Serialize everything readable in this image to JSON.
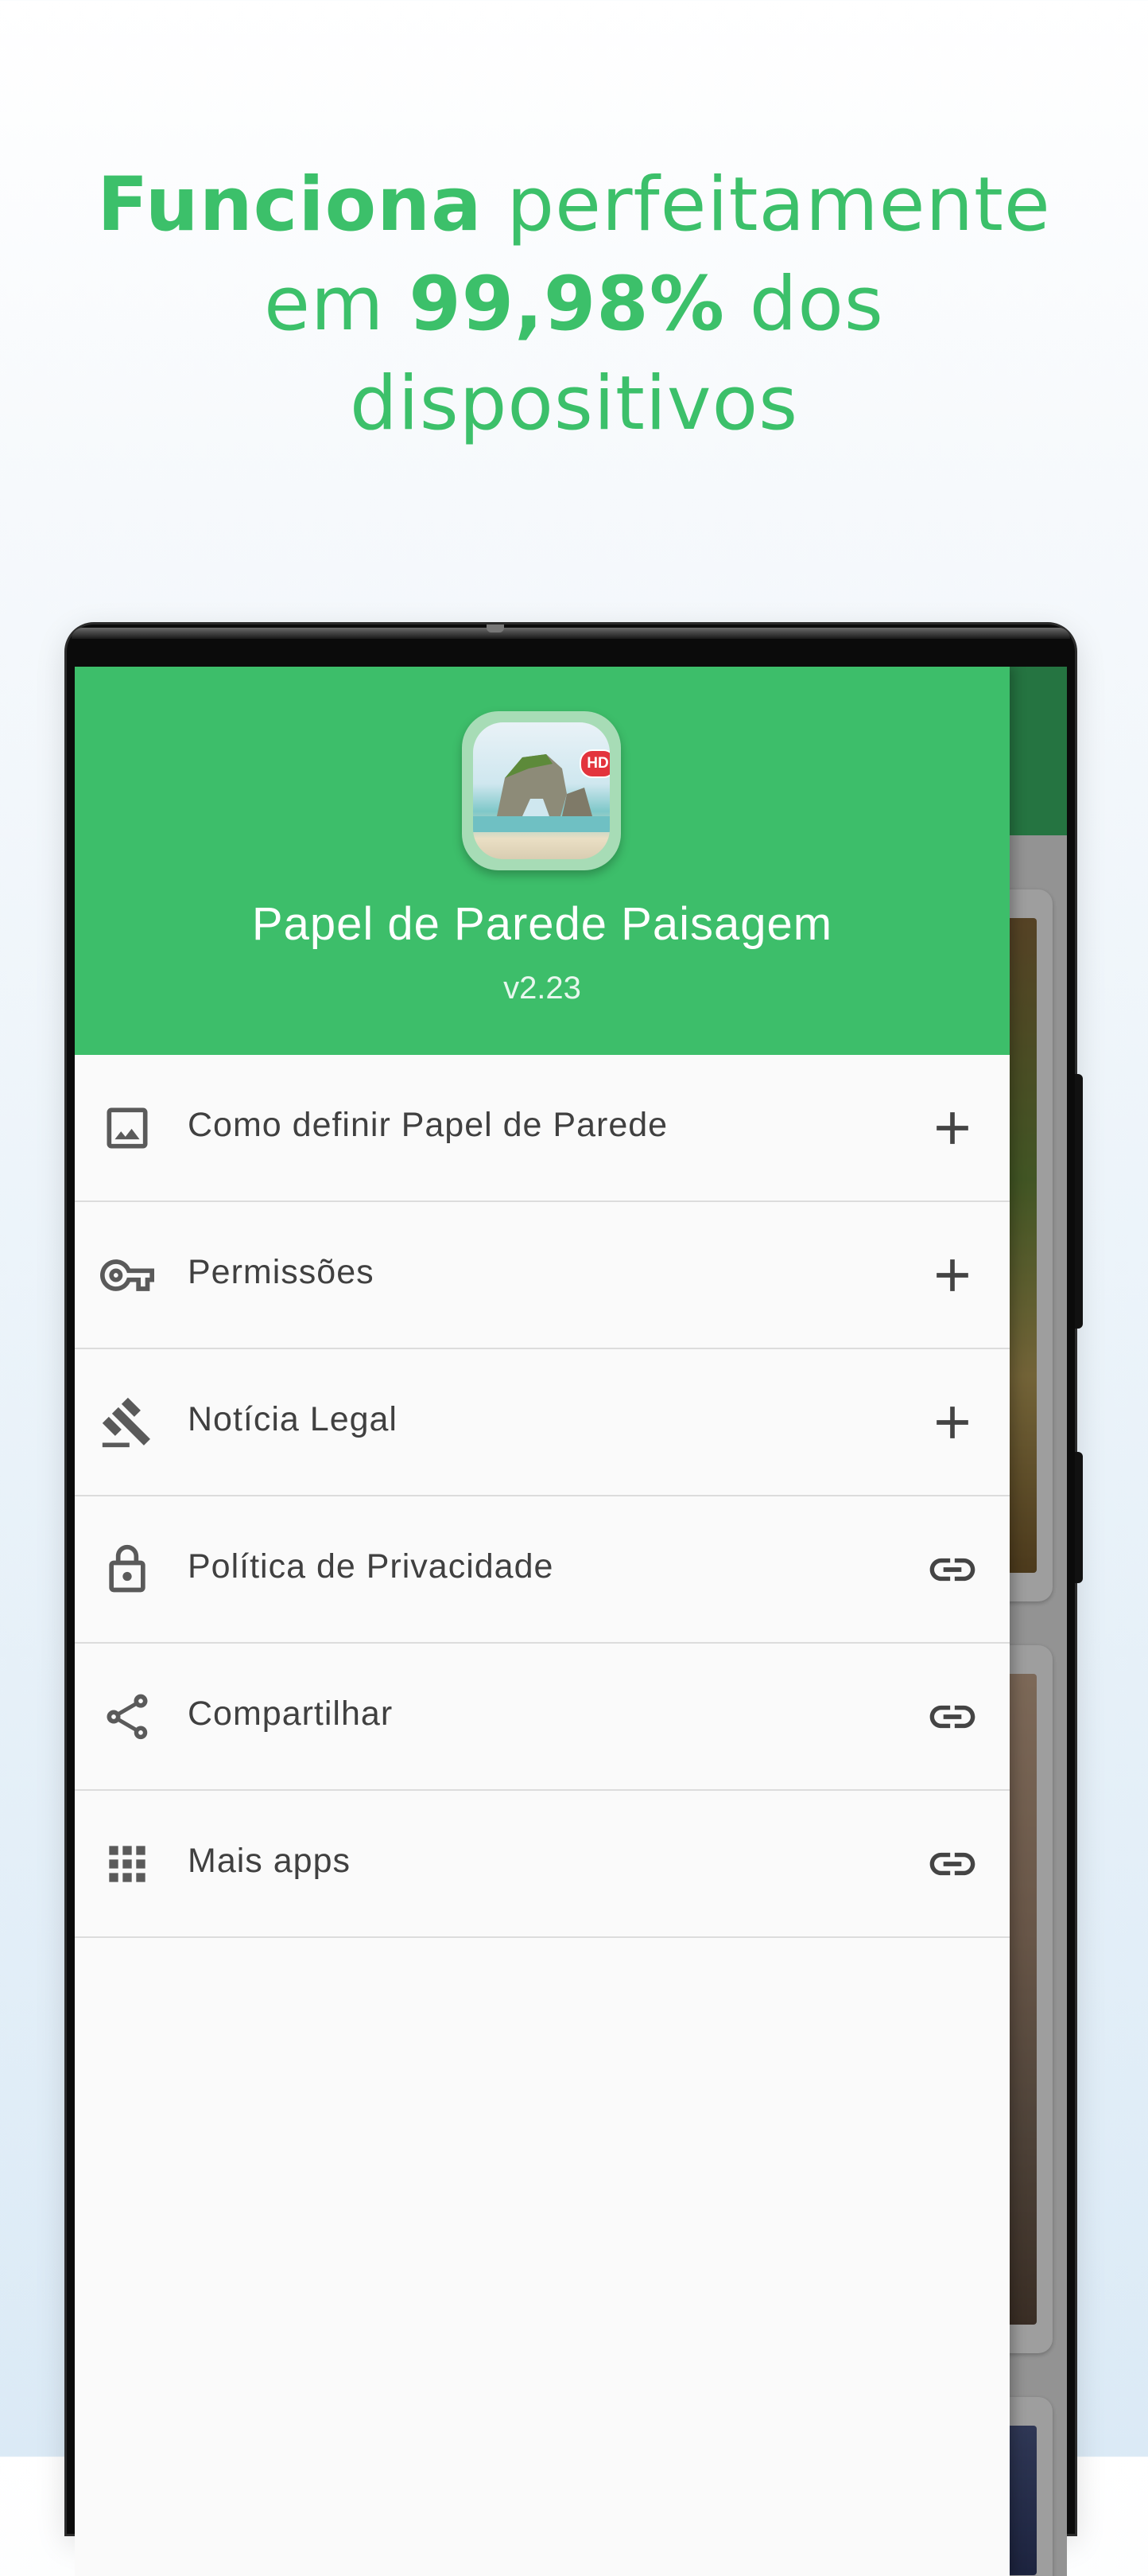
{
  "headline": {
    "part1_bold": "Funciona",
    "part2": " perfeitamente",
    "part3": "em ",
    "part4_bold": "99,98%",
    "part5": " dos",
    "part6": "dispositivos"
  },
  "drawer": {
    "app_name": "Papel de Parede Paisagem",
    "version": "v2.23",
    "badge": "HD",
    "items": [
      {
        "label": "Como definir Papel de Parede",
        "icon": "image-icon",
        "action": "plus-icon"
      },
      {
        "label": "Permissões",
        "icon": "key-icon",
        "action": "plus-icon"
      },
      {
        "label": "Notícia Legal",
        "icon": "gavel-icon",
        "action": "plus-icon"
      },
      {
        "label": "Política de Privacidade",
        "icon": "lock-icon",
        "action": "link-icon"
      },
      {
        "label": "Compartilhar",
        "icon": "share-icon",
        "action": "link-icon"
      },
      {
        "label": "Mais apps",
        "icon": "apps-grid-icon",
        "action": "link-icon"
      }
    ]
  },
  "colors": {
    "accent_green": "#3cbe6a",
    "headline_green": "#3cc06a",
    "badge_red": "#e3343d",
    "icon_gray": "#5a5a5a"
  }
}
